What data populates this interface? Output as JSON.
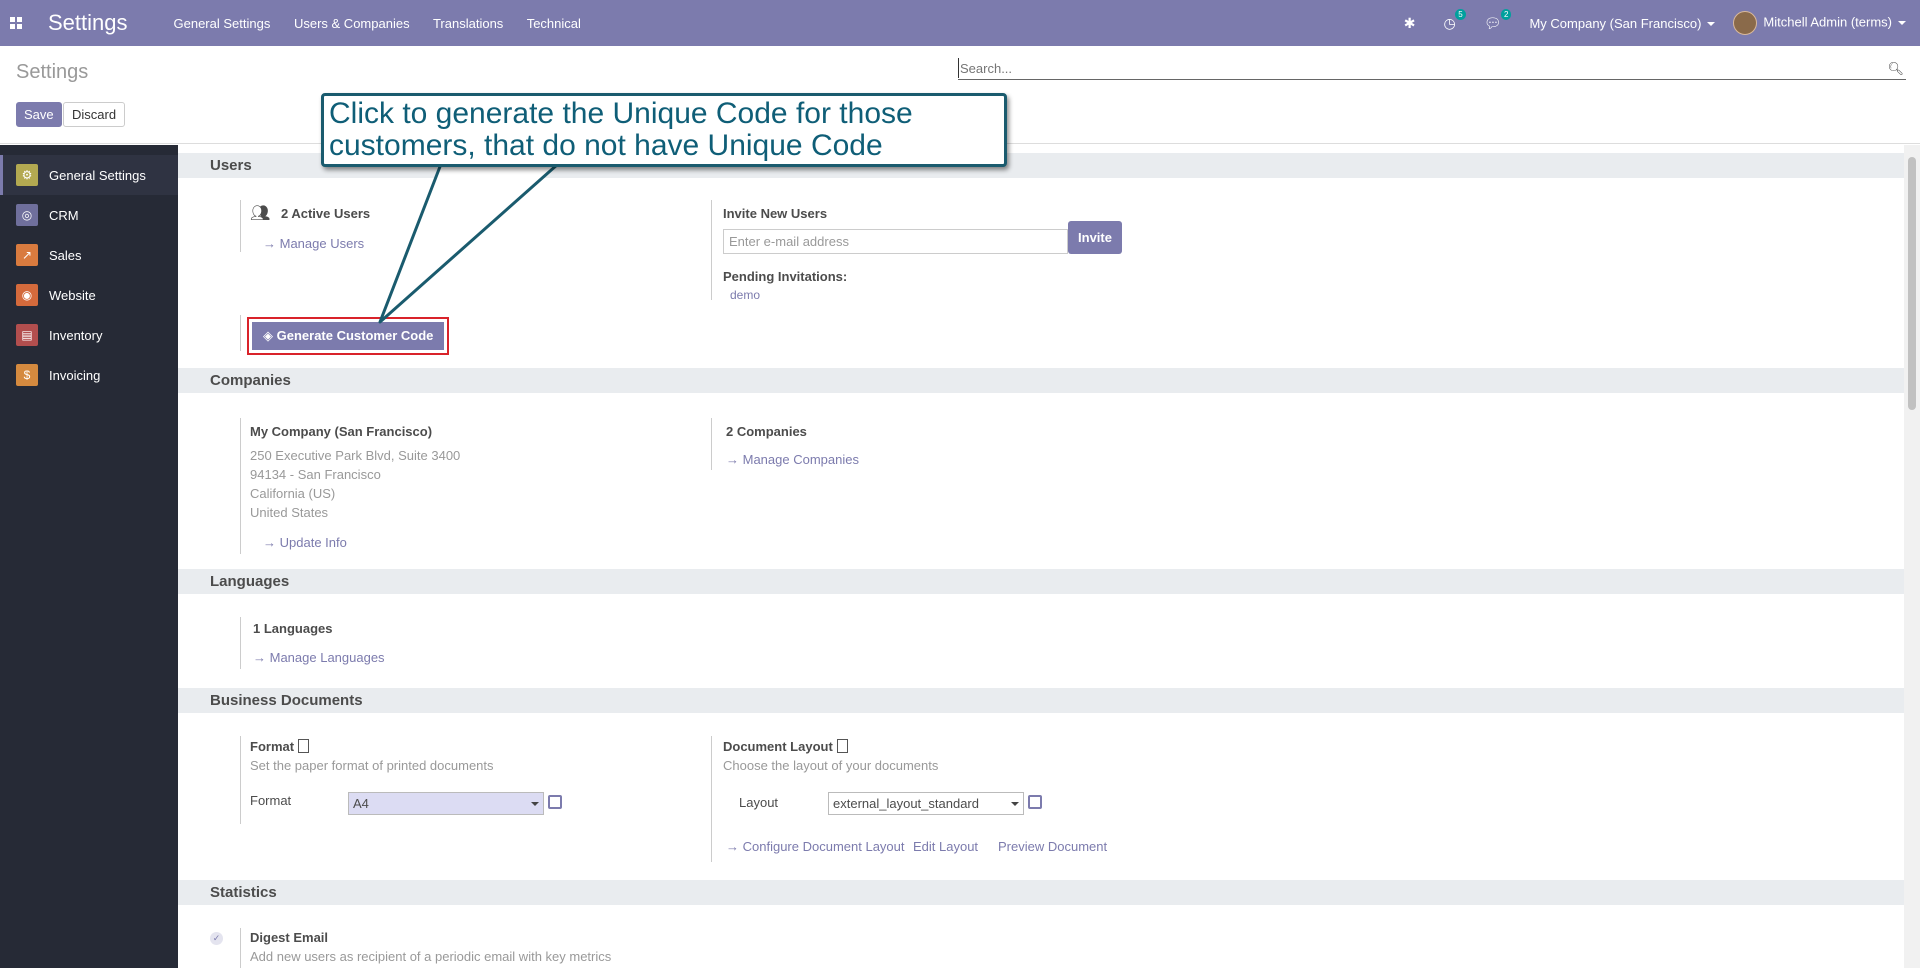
{
  "navbar": {
    "brand": "Settings",
    "menu": [
      "General Settings",
      "Users & Companies",
      "Translations",
      "Technical"
    ],
    "activity_badge": "5",
    "message_badge": "2",
    "company": "My Company (San Francisco)",
    "user": "Mitchell Admin (terms)"
  },
  "control": {
    "breadcrumb": "Settings",
    "search_placeholder": "Search...",
    "save_label": "Save",
    "discard_label": "Discard"
  },
  "sidebar": {
    "items": [
      {
        "label": "General Settings",
        "icon": "gear-icon",
        "color": "#b3a951"
      },
      {
        "label": "CRM",
        "icon": "handshake-icon",
        "color": "#6f6f9c"
      },
      {
        "label": "Sales",
        "icon": "chart-icon",
        "color": "#d97b3f"
      },
      {
        "label": "Website",
        "icon": "globe-icon",
        "color": "#d46a3c"
      },
      {
        "label": "Inventory",
        "icon": "box-icon",
        "color": "#b24e4e"
      },
      {
        "label": "Invoicing",
        "icon": "invoice-icon",
        "color": "#d58a3f"
      }
    ]
  },
  "users": {
    "title": "Users",
    "active_users": "2 Active Users",
    "manage_users": "Manage Users",
    "invite_title": "Invite New Users",
    "invite_placeholder": "Enter e-mail address",
    "invite_button": "Invite",
    "pending_title": "Pending Invitations:",
    "pending_user": "demo",
    "generate_button": "Generate Customer Code"
  },
  "companies": {
    "title": "Companies",
    "company_name": "My Company (San Francisco)",
    "address": [
      "250 Executive Park Blvd, Suite 3400",
      "94134 - San Francisco",
      "California (US)",
      "United States"
    ],
    "update_info": "Update Info",
    "count": "2 Companies",
    "manage": "Manage Companies"
  },
  "languages": {
    "title": "Languages",
    "count": "1 Languages",
    "manage": "Manage Languages"
  },
  "business_documents": {
    "title": "Business Documents",
    "format_title": "Format",
    "format_desc": "Set the paper format of printed documents",
    "format_label": "Format",
    "format_value": "A4",
    "layout_title": "Document Layout",
    "layout_desc": "Choose the layout of your documents",
    "layout_label": "Layout",
    "layout_value": "external_layout_standard",
    "configure": "Configure Document Layout",
    "edit": "Edit Layout",
    "preview": "Preview Document"
  },
  "statistics": {
    "title": "Statistics",
    "digest_title": "Digest Email",
    "digest_desc": "Add new users as recipient of a periodic email with key metrics"
  },
  "callout": {
    "text_line1": "Click to generate the Unique Code for those",
    "text_line2": "customers, that do not have Unique Code"
  }
}
